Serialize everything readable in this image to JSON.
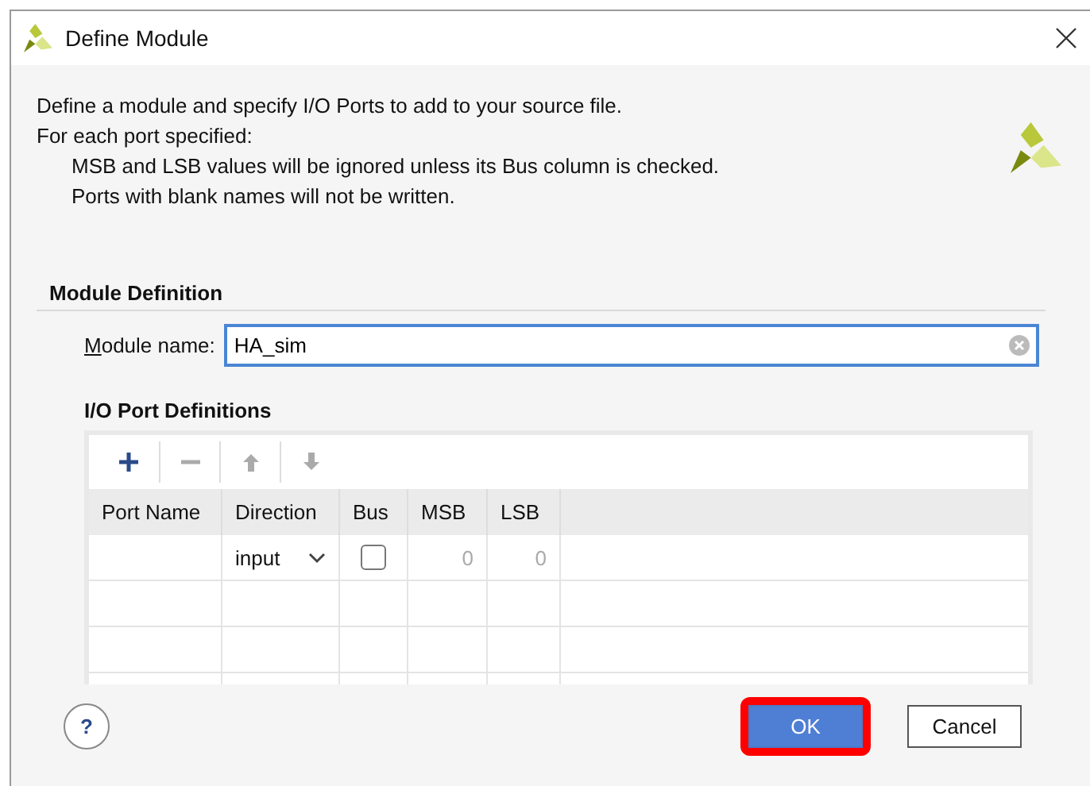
{
  "window": {
    "title": "Define Module"
  },
  "description": [
    "Define a module and specify I/O Ports to add to your source file.",
    "For each port specified:"
  ],
  "notes": [
    "MSB and LSB values will be ignored unless its Bus column is checked.",
    "Ports with blank names will not be written."
  ],
  "module_definition": {
    "heading": "Module Definition",
    "label": "Module name:",
    "value": "HA_sim"
  },
  "ports": {
    "heading": "I/O Port Definitions",
    "toolbar": [
      {
        "kind": "add",
        "disabled": false
      },
      {
        "kind": "remove",
        "disabled": true
      },
      {
        "kind": "up",
        "disabled": true
      },
      {
        "kind": "down",
        "disabled": true
      }
    ],
    "columns": [
      "Port Name",
      "Direction",
      "Bus",
      "MSB",
      "LSB"
    ],
    "rows": [
      {
        "name": "",
        "direction": "input",
        "bus": false,
        "msb": "0",
        "lsb": "0"
      }
    ]
  },
  "buttons": [
    {
      "label": "OK",
      "kind": "primary",
      "highlighted": true
    },
    {
      "label": "Cancel",
      "kind": "secondary",
      "highlighted": false
    }
  ],
  "help": "?"
}
